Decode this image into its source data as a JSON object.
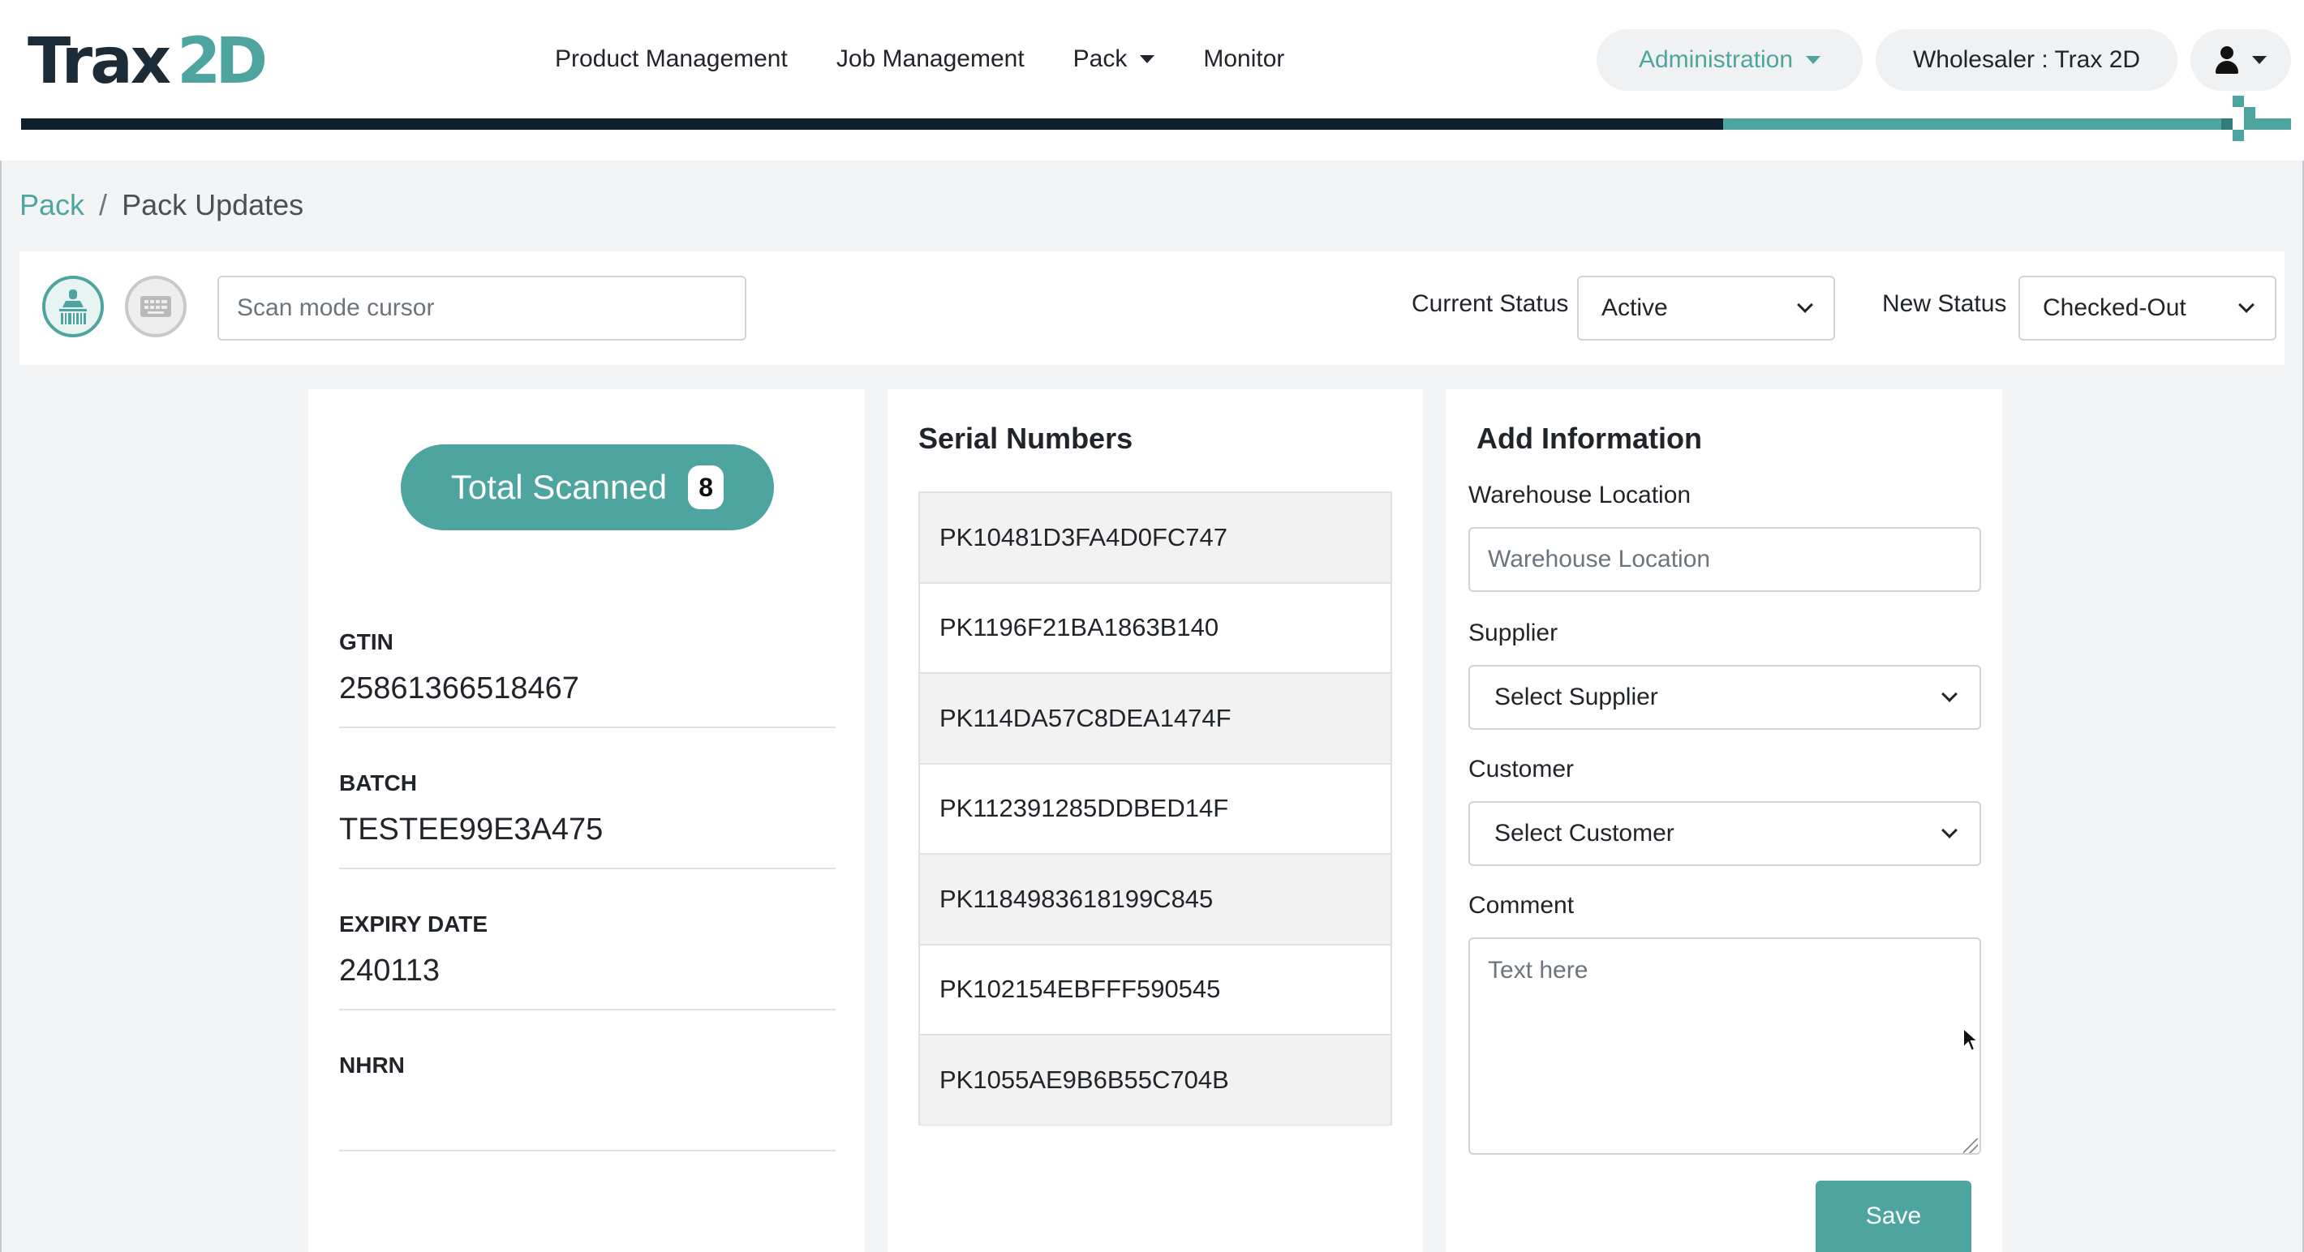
{
  "header": {
    "logo_text": "Trax",
    "logo_suffix_2": "2",
    "logo_suffix_d": "D",
    "nav": [
      {
        "label": "Product Management"
      },
      {
        "label": "Job Management"
      },
      {
        "label": "Pack"
      },
      {
        "label": "Monitor"
      }
    ],
    "administration_label": "Administration",
    "wholesaler_label": "Wholesaler : Trax 2D",
    "user_icon": "user-icon",
    "accent_color": "#4ea5a0",
    "dark_color": "#0e1e2b"
  },
  "breadcrumb": {
    "parent": "Pack",
    "separator": "/",
    "current": "Pack Updates"
  },
  "toolbar": {
    "scan_mode_icon": "barcode-scanner-icon",
    "keyboard_mode_icon": "keyboard-icon",
    "scan_placeholder": "Scan mode cursor",
    "current_status_label": "Current Status",
    "current_status_value": "Active",
    "new_status_label": "New Status",
    "new_status_value": "Checked-Out"
  },
  "summary": {
    "total_scanned_label": "Total Scanned",
    "total_scanned_count": "8",
    "fields": [
      {
        "label": "GTIN",
        "value": "25861366518467"
      },
      {
        "label": "BATCH",
        "value": "TESTEE99E3A475"
      },
      {
        "label": "EXPIRY DATE",
        "value": "240113"
      },
      {
        "label": "NHRN",
        "value": ""
      }
    ]
  },
  "serials": {
    "title": "Serial Numbers",
    "items": [
      "PK10481D3FA4D0FC747",
      "PK1196F21BA1863B140",
      "PK114DA57C8DEA1474F",
      "PK112391285DDBED14F",
      "PK1184983618199C845",
      "PK102154EBFFF590545",
      "PK1055AE9B6B55C704B"
    ]
  },
  "add_info": {
    "title": "Add Information",
    "warehouse_label": "Warehouse Location",
    "warehouse_placeholder": "Warehouse Location",
    "supplier_label": "Supplier",
    "supplier_value": "Select Supplier",
    "customer_label": "Customer",
    "customer_value": "Select Customer",
    "comment_label": "Comment",
    "comment_placeholder": "Text here",
    "save_label": "Save"
  }
}
